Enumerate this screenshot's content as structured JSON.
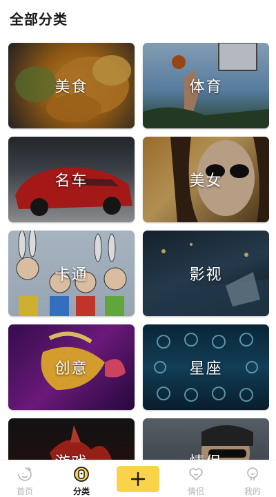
{
  "header": {
    "title": "全部分类"
  },
  "categories": [
    {
      "label": "美食"
    },
    {
      "label": "体育"
    },
    {
      "label": "名车"
    },
    {
      "label": "美女"
    },
    {
      "label": "卡通"
    },
    {
      "label": "影视"
    },
    {
      "label": "创意"
    },
    {
      "label": "星座"
    },
    {
      "label": "游戏"
    },
    {
      "label": "情侣"
    }
  ],
  "tabbar": {
    "items": [
      {
        "label": "首页",
        "icon": "home-smile-icon"
      },
      {
        "label": "分类",
        "icon": "category-icon",
        "active": true
      },
      {
        "label": "",
        "icon": "plus-icon"
      },
      {
        "label": "情侣",
        "icon": "heart-icon"
      },
      {
        "label": "我的",
        "icon": "profile-icon"
      }
    ],
    "accent": "#f9d34a"
  }
}
